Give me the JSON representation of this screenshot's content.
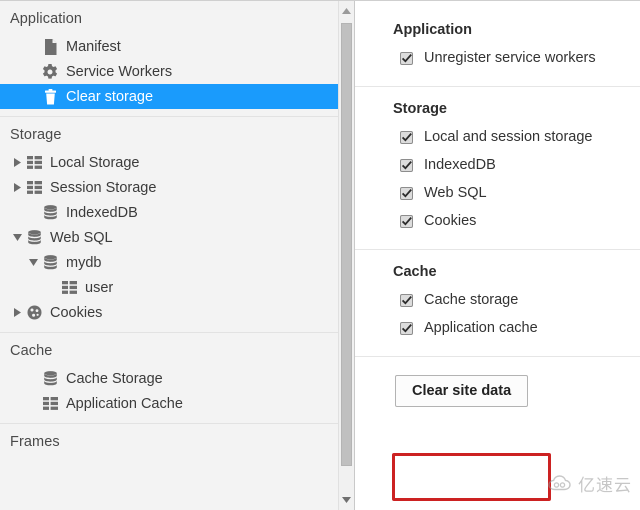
{
  "left_panel": {
    "sections": [
      {
        "title": "Application",
        "items": [
          {
            "label": "Manifest",
            "icon": "document-icon",
            "indent": 1,
            "twisty": "none",
            "selected": false
          },
          {
            "label": "Service Workers",
            "icon": "gear-icon",
            "indent": 1,
            "twisty": "none",
            "selected": false
          },
          {
            "label": "Clear storage",
            "icon": "trash-icon",
            "indent": 1,
            "twisty": "none",
            "selected": true
          }
        ]
      },
      {
        "title": "Storage",
        "items": [
          {
            "label": "Local Storage",
            "icon": "table-icon",
            "indent": 0,
            "twisty": "collapsed",
            "selected": false
          },
          {
            "label": "Session Storage",
            "icon": "table-icon",
            "indent": 0,
            "twisty": "collapsed",
            "selected": false
          },
          {
            "label": "IndexedDB",
            "icon": "database-icon",
            "indent": 1,
            "twisty": "none",
            "selected": false
          },
          {
            "label": "Web SQL",
            "icon": "database-icon",
            "indent": 0,
            "twisty": "expanded",
            "selected": false
          },
          {
            "label": "mydb",
            "icon": "database-icon",
            "indent": 1,
            "twisty": "expanded",
            "selected": false
          },
          {
            "label": "user",
            "icon": "table-icon",
            "indent": 2,
            "twisty": "none",
            "selected": false
          },
          {
            "label": "Cookies",
            "icon": "cookie-icon",
            "indent": 0,
            "twisty": "collapsed",
            "selected": false
          }
        ]
      },
      {
        "title": "Cache",
        "items": [
          {
            "label": "Cache Storage",
            "icon": "database-icon",
            "indent": 1,
            "twisty": "none",
            "selected": false
          },
          {
            "label": "Application Cache",
            "icon": "table-icon",
            "indent": 1,
            "twisty": "none",
            "selected": false
          }
        ]
      },
      {
        "title": "Frames",
        "items": []
      }
    ],
    "scrollbar": {
      "up_arrow_icon": "scroll-up-arrow-icon",
      "down_arrow_icon": "scroll-down-arrow-icon"
    }
  },
  "right_panel": {
    "groups": [
      {
        "title": "Application",
        "options": [
          {
            "label": "Unregister service workers",
            "checked": true
          }
        ]
      },
      {
        "title": "Storage",
        "options": [
          {
            "label": "Local and session storage",
            "checked": true
          },
          {
            "label": "IndexedDB",
            "checked": true
          },
          {
            "label": "Web SQL",
            "checked": true
          },
          {
            "label": "Cookies",
            "checked": true
          }
        ]
      },
      {
        "title": "Cache",
        "options": [
          {
            "label": "Cache storage",
            "checked": true
          },
          {
            "label": "Application cache",
            "checked": true
          }
        ]
      }
    ],
    "clear_button_label": "Clear site data"
  },
  "annotation": {
    "color": "#cc2222"
  },
  "watermark": {
    "text": "亿速云",
    "logo_icon": "cloud-logo-icon"
  },
  "colors": {
    "selection_blue": "#1a9bfc",
    "left_bg": "#f3f3f3",
    "right_bg": "#ffffff",
    "icon_gray": "#6e6e6e"
  }
}
